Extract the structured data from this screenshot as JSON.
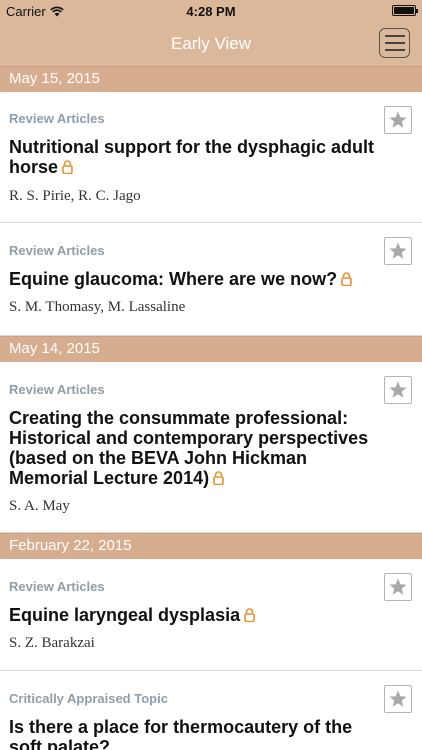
{
  "status_bar": {
    "carrier": "Carrier",
    "time": "4:28 PM"
  },
  "nav": {
    "title": "Early View"
  },
  "sections": [
    {
      "date": "May 15, 2015"
    },
    {
      "date": "May 14, 2015"
    },
    {
      "date": "February 22, 2015"
    }
  ],
  "articles": [
    {
      "category": "Review Articles",
      "title": "Nutritional support for the dysphagic adult horse",
      "authors": "R. S. Pirie, R. C. Jago",
      "open_access": true
    },
    {
      "category": "Review Articles",
      "title": "Equine glaucoma: Where are we now?",
      "authors": "S. M. Thomasy, M. Lassaline",
      "open_access": true
    },
    {
      "category": "Review Articles",
      "title": "Creating the consummate professional: Historical and contemporary perspectives (based on the BEVA John Hickman Memorial Lecture 2014)",
      "authors": "S. A. May",
      "open_access": true
    },
    {
      "category": "Review Articles",
      "title": "Equine laryngeal dysplasia",
      "authors": "S. Z. Barakzai",
      "open_access": true
    },
    {
      "category": "Critically Appraised Topic",
      "title": "Is there a place for thermocautery of the soft palate?",
      "authors": "",
      "open_access": false
    }
  ],
  "icons": {
    "lock": "open-access-lock-icon",
    "star": "star-icon",
    "menu": "menu-icon"
  },
  "colors": {
    "header": "#dcb89b",
    "section": "#d6ad8f",
    "category": "#8e9eaa",
    "lock": "#e8922f"
  }
}
